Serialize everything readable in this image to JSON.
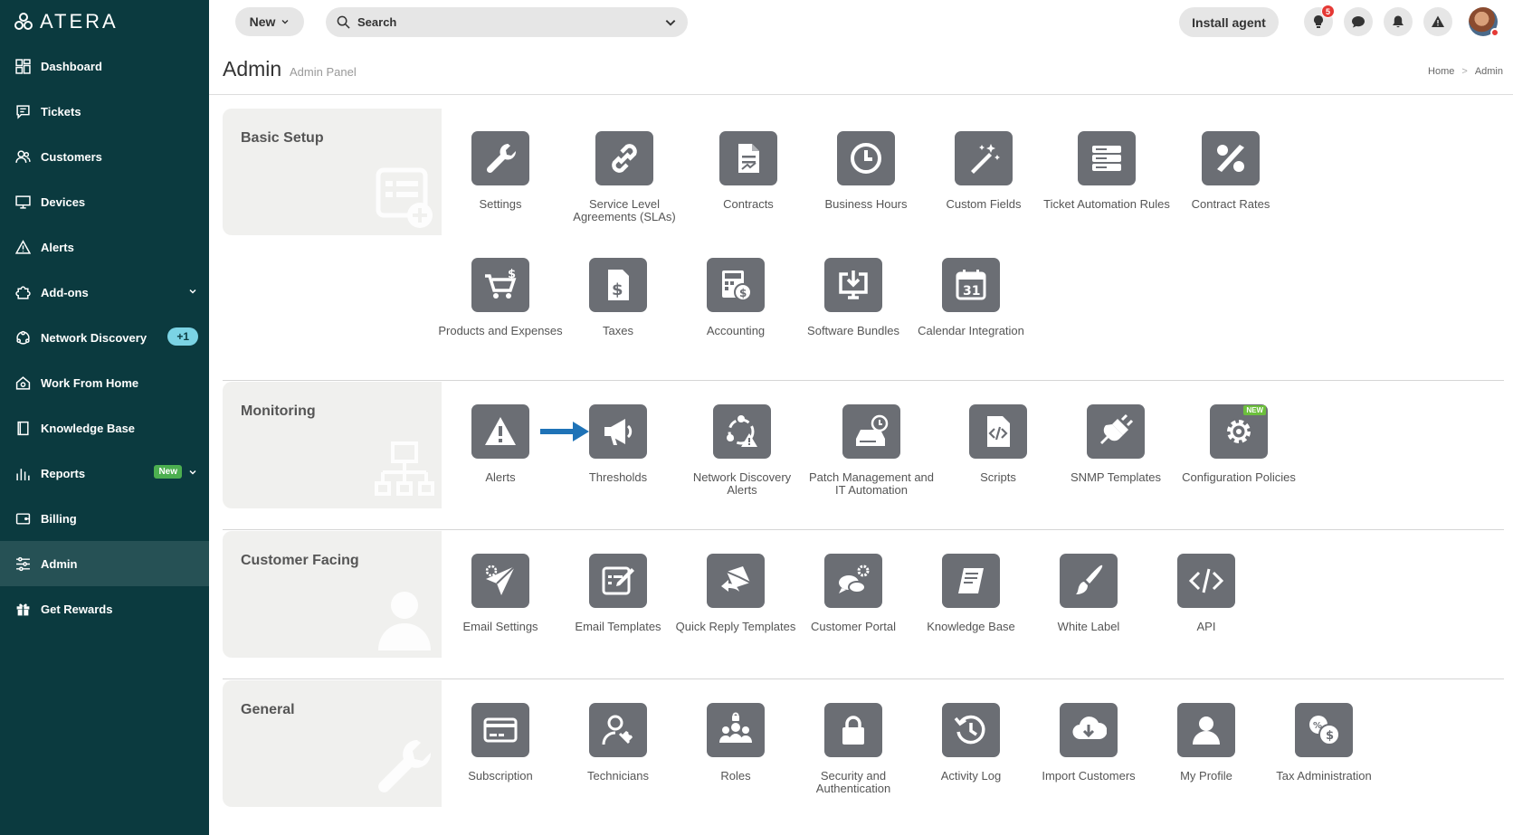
{
  "brand": {
    "name": "ATERA"
  },
  "sidebar": {
    "items": [
      {
        "label": "Dashboard",
        "icon": "dashboard-icon"
      },
      {
        "label": "Tickets",
        "icon": "tickets-icon"
      },
      {
        "label": "Customers",
        "icon": "customers-icon"
      },
      {
        "label": "Devices",
        "icon": "devices-icon"
      },
      {
        "label": "Alerts",
        "icon": "alerts-icon"
      },
      {
        "label": "Add-ons",
        "icon": "addons-icon"
      },
      {
        "label": "Network Discovery",
        "icon": "network-discovery-icon",
        "badge": "+1"
      },
      {
        "label": "Work From Home",
        "icon": "home-icon"
      },
      {
        "label": "Knowledge Base",
        "icon": "book-icon"
      },
      {
        "label": "Reports",
        "icon": "reports-icon",
        "badge": "New"
      },
      {
        "label": "Billing",
        "icon": "billing-icon"
      },
      {
        "label": "Admin",
        "icon": "admin-icon",
        "active": true
      },
      {
        "label": "Get Rewards",
        "icon": "gift-icon"
      }
    ]
  },
  "topbar": {
    "new_label": "New",
    "search_placeholder": "Search",
    "install_label": "Install agent",
    "notification_count": "5"
  },
  "header": {
    "title": "Admin",
    "subtitle": "Admin Panel",
    "breadcrumb": [
      "Home",
      "Admin"
    ]
  },
  "sections": [
    {
      "title": "Basic Setup",
      "items": [
        "Settings",
        "Service Level Agreements (SLAs)",
        "Contracts",
        "Business Hours",
        "Custom Fields",
        "Ticket Automation Rules",
        "Contract Rates",
        "Products and Expenses",
        "Taxes",
        "Accounting",
        "Software Bundles",
        "Calendar Integration"
      ]
    },
    {
      "title": "Monitoring",
      "items": [
        "Alerts",
        "Thresholds",
        "Network Discovery Alerts",
        "Patch Management and IT Automation",
        "Scripts",
        "SNMP Templates",
        "Configuration Policies"
      ]
    },
    {
      "title": "Customer Facing",
      "items": [
        "Email Settings",
        "Email Templates",
        "Quick Reply Templates",
        "Customer Portal",
        "Knowledge Base",
        "White Label",
        "API"
      ]
    },
    {
      "title": "General",
      "items": [
        "Subscription",
        "Technicians",
        "Roles",
        "Security and Authentication",
        "Activity Log",
        "Import Customers",
        "My Profile",
        "Tax Administration"
      ]
    }
  ],
  "new_tag": "NEW",
  "colors": {
    "sidebar": "#0b3a3f",
    "sidebar_active": "#265155",
    "tile": "#6b6e74",
    "arrow": "#1f73b7"
  }
}
